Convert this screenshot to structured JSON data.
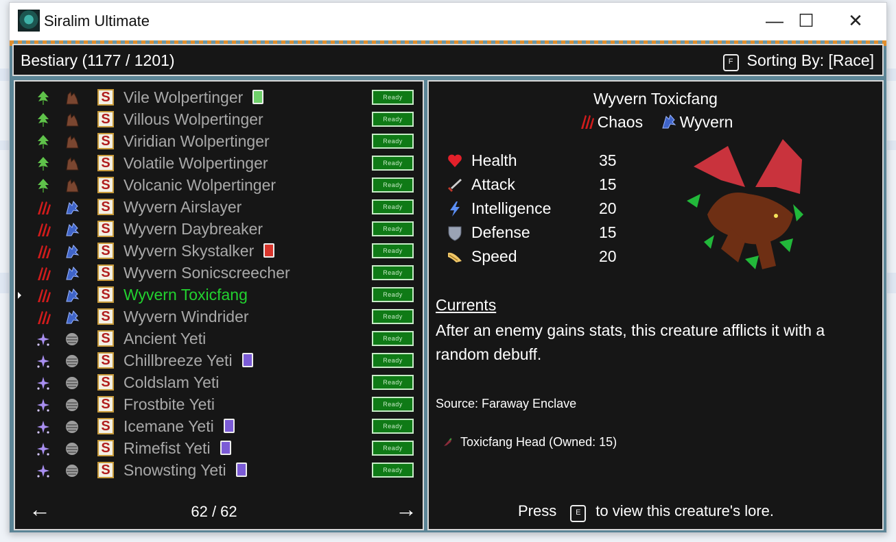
{
  "window": {
    "title": "Siralim Ultimate",
    "minimize_label": "—",
    "maximize_label": "☐",
    "close_label": "✕"
  },
  "header": {
    "title": "Bestiary (1177 / 1201)",
    "sort_key": "F",
    "sort_label": "Sorting By: [Race]"
  },
  "colors": {
    "selected": "#22d22f",
    "ready_bg": "#0f7a16",
    "panel_bg": "#161616"
  },
  "list": [
    {
      "name": "Vile Wolpertinger",
      "class": "life",
      "race": "wolpertinger",
      "trait": "green",
      "status": "Ready"
    },
    {
      "name": "Villous Wolpertinger",
      "class": "life",
      "race": "wolpertinger",
      "trait": "",
      "status": "Ready"
    },
    {
      "name": "Viridian Wolpertinger",
      "class": "life",
      "race": "wolpertinger",
      "trait": "",
      "status": "Ready"
    },
    {
      "name": "Volatile Wolpertinger",
      "class": "life",
      "race": "wolpertinger",
      "trait": "",
      "status": "Ready"
    },
    {
      "name": "Volcanic Wolpertinger",
      "class": "life",
      "race": "wolpertinger",
      "trait": "",
      "status": "Ready"
    },
    {
      "name": "Wyvern Airslayer",
      "class": "chaos",
      "race": "wyvern",
      "trait": "",
      "status": "Ready"
    },
    {
      "name": "Wyvern Daybreaker",
      "class": "chaos",
      "race": "wyvern",
      "trait": "",
      "status": "Ready"
    },
    {
      "name": "Wyvern Skystalker",
      "class": "chaos",
      "race": "wyvern",
      "trait": "red",
      "status": "Ready"
    },
    {
      "name": "Wyvern Sonicscreecher",
      "class": "chaos",
      "race": "wyvern",
      "trait": "",
      "status": "Ready"
    },
    {
      "name": "Wyvern Toxicfang",
      "class": "chaos",
      "race": "wyvern",
      "trait": "",
      "status": "Ready",
      "selected": true
    },
    {
      "name": "Wyvern Windrider",
      "class": "chaos",
      "race": "wyvern",
      "trait": "",
      "status": "Ready"
    },
    {
      "name": "Ancient Yeti",
      "class": "sorcery",
      "race": "yeti",
      "trait": "",
      "status": "Ready"
    },
    {
      "name": "Chillbreeze Yeti",
      "class": "sorcery",
      "race": "yeti",
      "trait": "purple",
      "status": "Ready"
    },
    {
      "name": "Coldslam Yeti",
      "class": "sorcery",
      "race": "yeti",
      "trait": "",
      "status": "Ready"
    },
    {
      "name": "Frostbite Yeti",
      "class": "sorcery",
      "race": "yeti",
      "trait": "",
      "status": "Ready"
    },
    {
      "name": "Icemane Yeti",
      "class": "sorcery",
      "race": "yeti",
      "trait": "purple",
      "status": "Ready"
    },
    {
      "name": "Rimefist Yeti",
      "class": "sorcery",
      "race": "yeti",
      "trait": "purple",
      "status": "Ready"
    },
    {
      "name": "Snowsting Yeti",
      "class": "sorcery",
      "race": "yeti",
      "trait": "purple",
      "status": "Ready"
    }
  ],
  "pagination": {
    "prev_label": "←",
    "next_label": "→",
    "page": "62 / 62"
  },
  "detail": {
    "name": "Wyvern Toxicfang",
    "class_label": "Chaos",
    "race_label": "Wyvern",
    "stats": [
      {
        "icon": "heart-icon",
        "label": "Health",
        "value": "35"
      },
      {
        "icon": "sword-icon",
        "label": "Attack",
        "value": "15"
      },
      {
        "icon": "lightning-icon",
        "label": "Intelligence",
        "value": "20"
      },
      {
        "icon": "shield-icon",
        "label": "Defense",
        "value": "15"
      },
      {
        "icon": "wing-icon",
        "label": "Speed",
        "value": "20"
      }
    ],
    "trait_heading": "Currents",
    "trait_text": "After an enemy gains stats, this creature afflicts it with a random debuff.",
    "source": "Source: Faraway Enclave",
    "material": "Toxicfang Head (Owned: 15)",
    "lore_prefix": "Press",
    "lore_key": "E",
    "lore_suffix": "to view this creature's lore."
  }
}
